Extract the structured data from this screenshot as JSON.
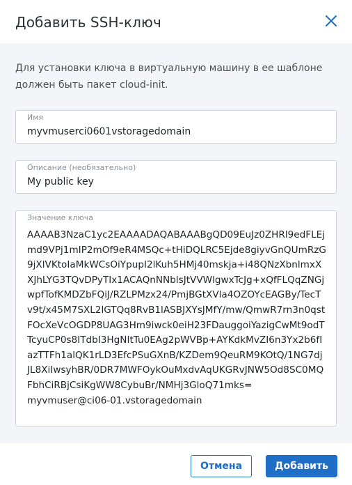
{
  "dialog": {
    "title": "Добавить SSH-ключ",
    "close_icon": "close-icon",
    "hint": "Для установки ключа в виртуальную машину в ее шаблоне должен быть пакет cloud-init."
  },
  "fields": {
    "name": {
      "label": "Имя",
      "value": "myvmuserci0601vstoragedomain"
    },
    "description": {
      "label": "Описание (необязательно)",
      "value": "My public key"
    },
    "key": {
      "label": "Значение ключа",
      "value": "AAAAB3NzaC1yc2EAAAADAQABAAABgQD09EuJz0ZHRl9edFLEj\nmd9VPj1mIP2mOf9eR4MSQc+tHiDQLRC5Ejde8giyvGnQUmRzG\n9jXlVKtoIaMkWCsOiYpupI2lKuh5HMj40mskja+i48QNzXbnlmxX\nXJhLYG3TQvDPyTIx1ACAQnNNblsJtVVWlgwxTcJg+xQfFLQqZNGj\nwpfTofKMDZbFQiJ/RZLPMzx24/PmjBGtXVla4OZOYcEAGBy/TecT\nv9t/x45M7SXL2lGTQq8RvB1lASBJXYsJMfY/mw/QmwR7rn3n0qst\nFOcXeVcOGDP8UAG3Hm9iwck0eiH23FDauggoiYazigCwMt9odT\nTcyuCP0s8ITdbI3HgNItTu0EAg2pWVBp+AYKdkMvZI6n3Yx2b6fI\nazTTFh1alQK1rLD3EfcPSuGXnB/KZDem9QeuRM9KOtQ/1NG7dj\nJL8XiIwsyhBR/0DR7MWFOykOuMxdvAqUKGRvJNW5Od8SC0MQ\nFbhCiRBjCsiKgWW8CybuBr/NMHj3GloQ71mks=\nmyvmuser@ci06-01.vstoragedomain"
    }
  },
  "footer": {
    "cancel_label": "Отмена",
    "add_label": "Добавить"
  },
  "colors": {
    "accent": "#1f6fc8",
    "body_bg": "#f4f5f8",
    "border": "#cfd4dc"
  }
}
